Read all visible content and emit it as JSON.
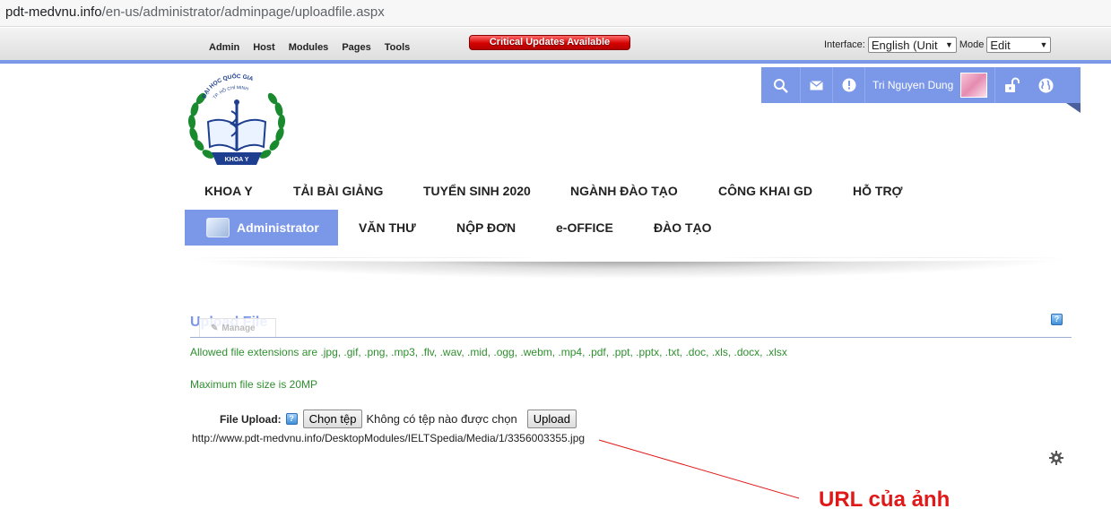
{
  "browser": {
    "url_domain": "pdt-medvnu.info",
    "url_path": "/en-us/administrator/adminpage/uploadfile.aspx"
  },
  "control_bar": {
    "menu": [
      "Admin",
      "Host",
      "Modules",
      "Pages",
      "Tools"
    ],
    "critical_updates": "Critical Updates Available",
    "interface_label": "Interface:",
    "interface_value": "English (Unit",
    "mode_label": "Mode",
    "mode_value": "Edit"
  },
  "user_bar": {
    "user_name": "Tri Nguyen Dung",
    "icons": [
      "search-icon",
      "mail-icon",
      "alert-icon",
      "avatar",
      "unlock-icon",
      "globe-icon"
    ],
    "color": "#7b97e8"
  },
  "logo": {
    "text_top": "ĐẠI HỌC QUỐC GIA",
    "text_city": "TP. HỒ CHÍ MINH",
    "text_bottom": "KHOA Y"
  },
  "main_menu": [
    "KHOA Y",
    "TẢI BÀI GIẢNG",
    "TUYỂN SINH 2020",
    "NGÀNH ĐÀO TẠO",
    "CÔNG KHAI GD",
    "HỖ TRỢ"
  ],
  "sub_menu": {
    "active": "Administrator",
    "items": [
      "VĂN THƯ",
      "NỘP ĐƠN",
      "e-OFFICE",
      "ĐÀO TẠO"
    ]
  },
  "module": {
    "title": "Upload File",
    "manage_label": "Manage",
    "allowed_ext": "Allowed file extensions are .jpg, .gif, .png, .mp3, .flv, .wav, .mid, .ogg, .webm, .mp4, .pdf, .ppt, .pptx, .txt, .doc, .xls, .docx, .xlsx",
    "max_size": "Maximum file size is 20MP",
    "file_upload_label": "File Upload:",
    "choose_file": "Chọn tệp",
    "no_file": "Không có tệp nào được chọn",
    "upload_button": "Upload",
    "file_url": "http://www.pdt-medvnu.info/DesktopModules/IELTSpedia/Media/1/3356003355.jpg"
  },
  "annotation": {
    "text": "URL của ảnh",
    "color": "#e01818"
  }
}
